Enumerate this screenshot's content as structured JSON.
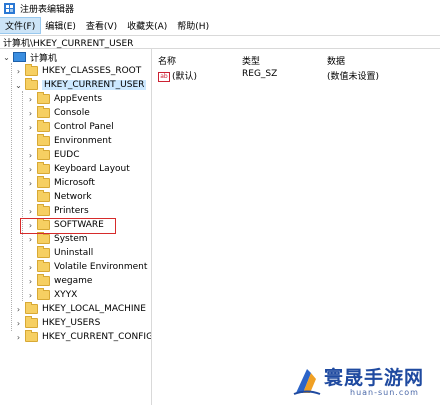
{
  "window": {
    "title": "注册表编辑器"
  },
  "menu": [
    "文件(F)",
    "编辑(E)",
    "查看(V)",
    "收藏夹(A)",
    "帮助(H)"
  ],
  "address": "计算机\\HKEY_CURRENT_USER",
  "tree": {
    "root": "计算机",
    "hives": [
      {
        "label": "HKEY_CLASSES_ROOT"
      },
      {
        "label": "HKEY_CURRENT_USER"
      },
      {
        "label": "HKEY_LOCAL_MACHINE"
      },
      {
        "label": "HKEY_USERS"
      },
      {
        "label": "HKEY_CURRENT_CONFIG"
      }
    ],
    "current_user_children": [
      "AppEvents",
      "Console",
      "Control Panel",
      "Environment",
      "EUDC",
      "Keyboard Layout",
      "Microsoft",
      "Network",
      "Printers",
      "SOFTWARE",
      "System",
      "Uninstall",
      "Volatile Environment",
      "wegame",
      "XYYX"
    ]
  },
  "list": {
    "columns": {
      "name": "名称",
      "type": "类型",
      "data": "数据"
    },
    "rows": [
      {
        "name": "(默认)",
        "type": "REG_SZ",
        "data": "(数值未设置)"
      }
    ]
  },
  "watermark": {
    "text": "寰晟手游网",
    "sub": "huan-sun.com"
  },
  "colors": {
    "selection": "#cce8ff",
    "highlight_box": "#d62b2b",
    "folder": "#f6cf62"
  }
}
